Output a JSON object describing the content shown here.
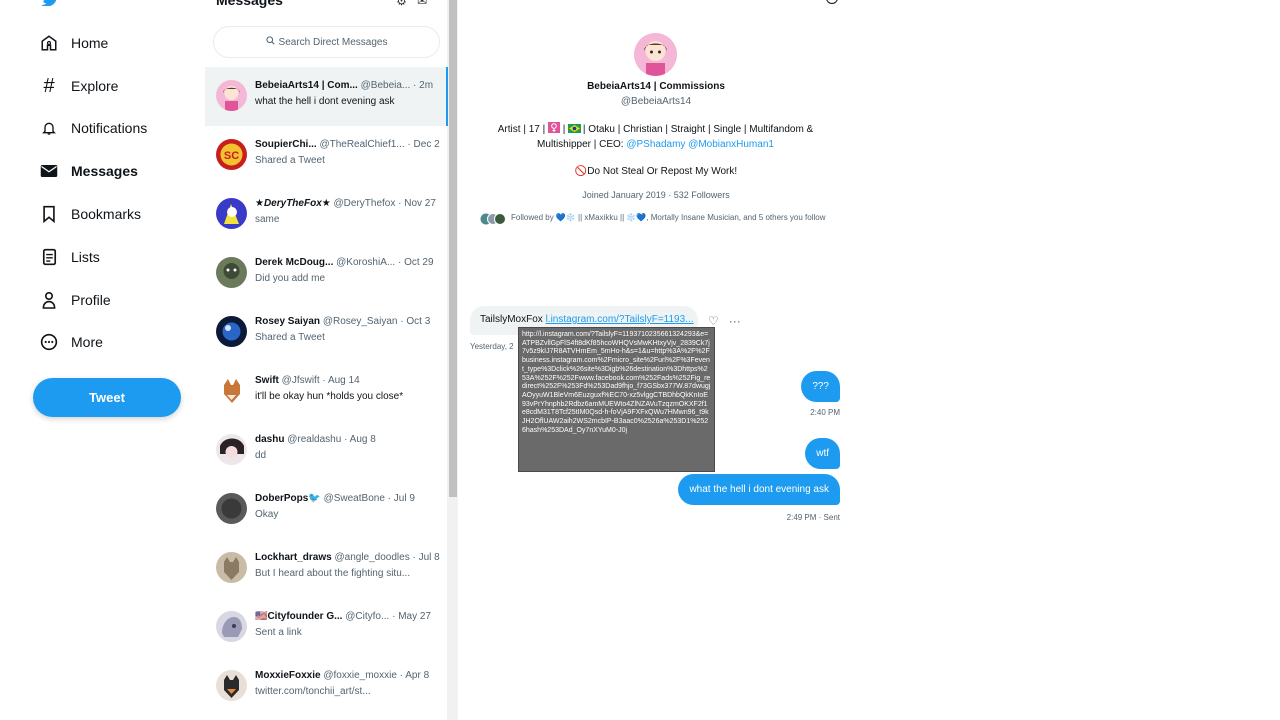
{
  "nav": {
    "items": [
      {
        "label": "Home",
        "icon": "home-icon"
      },
      {
        "label": "Explore",
        "icon": "hashtag-icon"
      },
      {
        "label": "Notifications",
        "icon": "bell-icon"
      },
      {
        "label": "Messages",
        "icon": "envelope-icon"
      },
      {
        "label": "Bookmarks",
        "icon": "bookmark-icon"
      },
      {
        "label": "Lists",
        "icon": "list-icon"
      },
      {
        "label": "Profile",
        "icon": "person-icon"
      },
      {
        "label": "More",
        "icon": "more-circle-icon"
      }
    ],
    "tweet_label": "Tweet"
  },
  "messages": {
    "title": "Messages",
    "search_placeholder": "Search Direct Messages",
    "conversations": [
      {
        "name": "BebeiaArts14 | Com...",
        "handle": "@Bebeia...",
        "time": "2m",
        "preview": "what the hell i dont evening ask"
      },
      {
        "name": "SoupierChi...",
        "handle": "@TheRealChief1...",
        "time": "Dec 2",
        "preview": "Shared a Tweet"
      },
      {
        "name": "★DeryTheFox★",
        "handle": "@DeryThefox",
        "time": "Nov 27",
        "preview": "same"
      },
      {
        "name": "Derek McDoug...",
        "handle": "@KoroshiA...",
        "time": "Oct 29",
        "preview": "Did you add me"
      },
      {
        "name": "Rosey Saiyan",
        "handle": "@Rosey_Saiyan",
        "time": "Oct 3",
        "preview": "Shared a Tweet"
      },
      {
        "name": "Swift",
        "handle": "@Jfswift",
        "time": "Aug 14",
        "preview": "it'll be okay hun *holds you close*"
      },
      {
        "name": "dashu",
        "handle": "@realdashu",
        "time": "Aug 8",
        "preview": "dd"
      },
      {
        "name": "DoberPops🐦",
        "handle": "@SweatBone",
        "time": "Jul 9",
        "preview": "Okay"
      },
      {
        "name": "Lockhart_draws",
        "handle": "@angle_doodles",
        "time": "Jul 8",
        "preview": "But I heard about the fighting situ..."
      },
      {
        "name": "🇺🇸Cityfounder G...",
        "handle": "@Cityfo...",
        "time": "May 27",
        "preview": "Sent a link"
      },
      {
        "name": "MoxxieFoxxie",
        "handle": "@foxxie_moxxie",
        "time": "Apr 8",
        "preview": "twitter.com/tonchii_art/st..."
      }
    ]
  },
  "profile": {
    "name": "BebeiaArts14 | Commissions",
    "handle": "@BebeiaArts14",
    "bio_part1": "Artist | 17 | ",
    "bio_part2": " | ",
    "bio_part3": " | Otaku | Christian | Straight | Single | Multifandom & Multishipper | CEO: ",
    "bio_mention1": "@PShadamy",
    "bio_mention2": "@MobianxHuman1",
    "warning": "🚫Do Not Steal Or Repost My Work!",
    "joined": "Joined January 2019 · 532 Followers",
    "followed_by": "Followed by 💙❄️ || xMaxikku || ❄️💙, Mortally Insane Musician, and 5 others you follow"
  },
  "chat": {
    "incoming": {
      "sender": "TailslyMoxFox",
      "link": "l.instagram.com/?TailslyF=1193...",
      "time": "Yesterday, 2"
    },
    "tooltip": "http://l.instagram.com/?TailslyF=119371023566132429​3&e=ATPBZvllGpFlS4ft8d​Kf85hcoWHQVsMwKHtxyVjv_2839Ck7j7v5z9kIJ7R8ATVHmEm_5mHo-h&s=1&u=http%3A%2F%2Fbusiness.instagram.com%2Fmicro_site%2Furl%2F%3Fevent_type%3Dclick%26site%3Digb%26destination%3Dhttps%253A%252F%252Fwww.facebook.com%252Fads%252Fig_redirect%252F%253Fd%253Dad9fhjo_f73GSbx377W.87dwugjAOyyuW1BleVm6Euzguxf%EC70-xz5vlggCTBDhbQkKnIoE93vPrYhnphb2Rdbz6amMUEWto4ZlNZAVuTzqzmOKXF2f1e8cdM31T8Tcf25tIM0Qsd-h-foVjA9FXFxQWu7HMwn96_t9kJH2OflUAW2aih2WS2mcbIP-B3aac0%2526a%253D1%2526hash%253DAd_Oy7nXYuM0-J0j",
    "outgoing": [
      {
        "text": "???",
        "time": "2:40 PM"
      },
      {
        "text": "wtf",
        "time": ""
      },
      {
        "text": "what the hell i dont evening ask",
        "time": "2:49 PM · Sent"
      }
    ]
  }
}
